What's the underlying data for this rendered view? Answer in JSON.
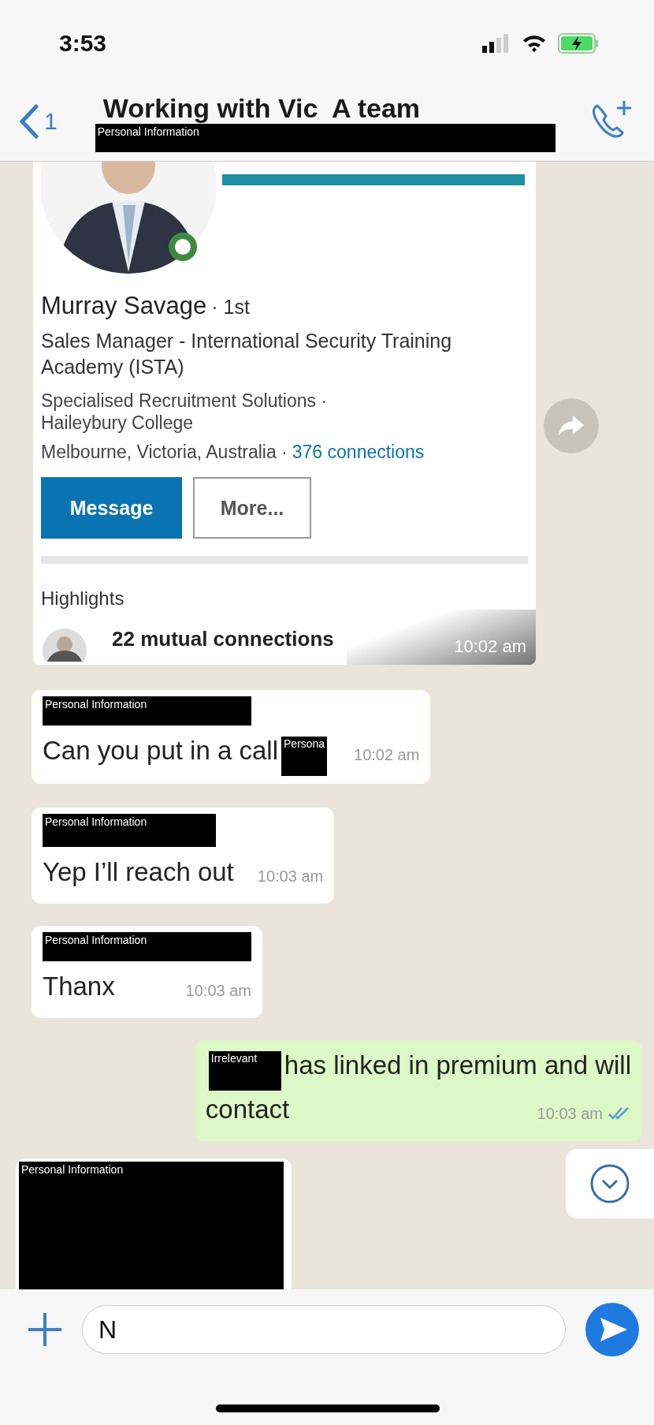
{
  "status_bar": {
    "time": "3:53"
  },
  "header": {
    "back_count": "1",
    "title": "Working with Vic  A team",
    "redaction_label": "Personal Information"
  },
  "profile_card": {
    "name": "Murray Savage",
    "degree": "· 1st",
    "online": true,
    "headline": "Sales Manager - International Security Training Academy (ISTA)",
    "affiliations": [
      "Specialised Recruitment Solutions ·",
      "Haileybury College"
    ],
    "location": "Melbourne, Victoria, Australia ·",
    "connections": "376 connections",
    "buttons": [
      {
        "label": "Message",
        "kind": "primary"
      },
      {
        "label": "More...",
        "kind": "secondary"
      }
    ],
    "section_title": "Highlights",
    "highlight": "22 mutual connections",
    "time": "10:02 am"
  },
  "messages": [
    {
      "kind": "incoming",
      "redaction_label": "Personal Information",
      "text": "Can you put in a call",
      "inline_redaction": "Persona",
      "redaction_first": false,
      "time": "10:02 am"
    },
    {
      "kind": "incoming",
      "redaction_label": "Personal Information",
      "text": "Yep I’ll reach out",
      "time": "10:03 am"
    },
    {
      "kind": "incoming",
      "redaction_label": "Personal Information",
      "text": "Thanx",
      "time": "10:03 am"
    },
    {
      "kind": "outgoing",
      "text_lines": [
        "has linked in premium and will",
        "contact"
      ],
      "inline_redaction": "Irrelevant",
      "redaction_first": true,
      "time": "10:03 am",
      "read": true
    },
    {
      "kind": "media",
      "redaction_label": "Personal Information"
    }
  ],
  "composer": {
    "value": "N"
  }
}
